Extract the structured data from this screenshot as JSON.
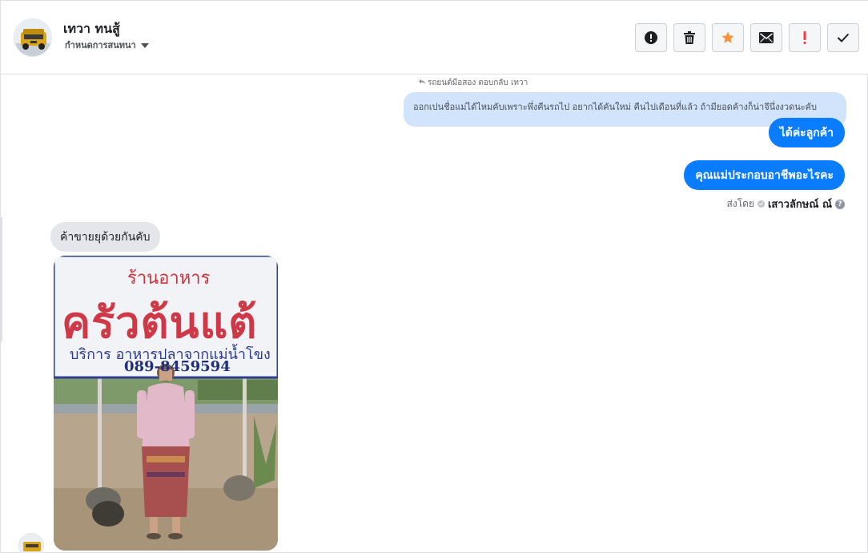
{
  "header": {
    "contact_name": "เทวา ทนสู้",
    "assign_label": "กำหนดการสนทนา",
    "actions": [
      {
        "name": "spam-button",
        "icon": "alert-circle-icon"
      },
      {
        "name": "delete-button",
        "icon": "trash-icon"
      },
      {
        "name": "star-button",
        "icon": "star-icon"
      },
      {
        "name": "unread-button",
        "icon": "envelope-icon"
      },
      {
        "name": "important-button",
        "icon": "exclamation-icon"
      },
      {
        "name": "done-button",
        "icon": "check-icon"
      }
    ]
  },
  "conversation": {
    "reply_context": "รถยนต์มือสอง ตอบกลับ เทวา",
    "quoted_message": "ออกเปนชื่อแม่ได้ไหมคับเพราะพึ่งคืนรถไป อยากได้คันใหม่ คืนไปเดือนที่แล้ว ถ้ามียอดค้างก็น่าจึนึ่งงวดนะคับ",
    "outgoing": [
      "ได้ค่ะลูกค้า",
      "คุณแม่ประกอบอาชีพอะไรคะ"
    ],
    "sent_by_label": "ส่งโดย",
    "agent_name": "เสาวลักษณ์ ณ์",
    "help_glyph": "?",
    "incoming_text": "ค้าขายยุด้วยกันคับ",
    "photo": {
      "sign_line1": "ร้านอาหาร",
      "sign_line2": "ครัวต้นแต้",
      "sign_line3": "บริการ  อาหารปลาจากแม่น้ำโขง",
      "sign_line4": "089-8459594"
    }
  },
  "colors": {
    "accent": "#0a7cff",
    "quoted_bg": "#d2e3fc",
    "incoming_bg": "#e4e6eb",
    "star": "#f7923b",
    "important": "#fa383e"
  }
}
